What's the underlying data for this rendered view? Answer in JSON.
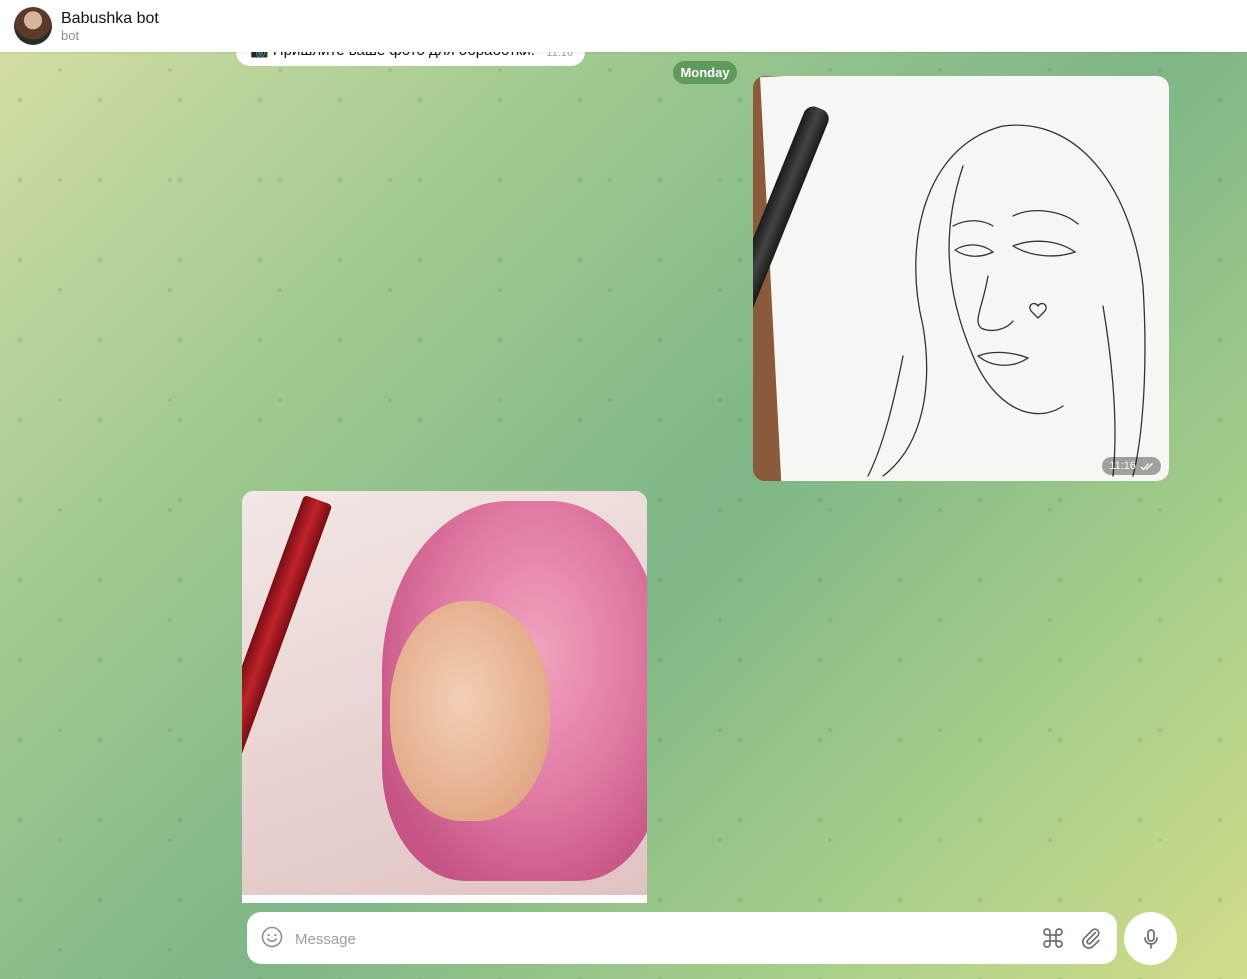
{
  "header": {
    "title": "Babushka bot",
    "subtitle": "bot"
  },
  "messages": {
    "cut_message": {
      "text": "📷 Пришлите ваше фото для обработки.",
      "time": "11:16"
    },
    "date_separator": "Monday",
    "outgoing_photo": {
      "time": "11:16",
      "status": "read"
    }
  },
  "composer": {
    "placeholder": "Message"
  },
  "icons": {
    "emoji": "smile-icon",
    "command": "command-icon",
    "attach": "paperclip-icon",
    "mic": "microphone-icon"
  }
}
